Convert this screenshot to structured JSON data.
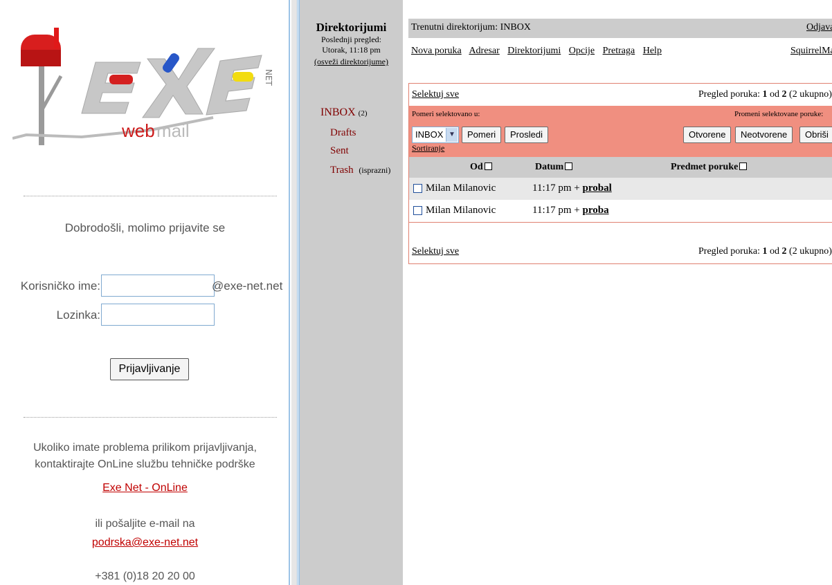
{
  "login": {
    "logo": {
      "brand_text": "exe",
      "brand_suffix": "NET",
      "tagline_bold": "web",
      "tagline_rest": "mail"
    },
    "welcome": "Dobrodošli, molimo prijavite se",
    "username_label": "Korisničko ime:",
    "username_value": "",
    "username_domain": "@exe-net.net",
    "password_label": "Lozinka:",
    "password_value": "",
    "login_button": "Prijavljivanje",
    "help_line1": "Ukoliko imate problema prilikom prijavljivanja,",
    "help_line2": "kontaktirajte OnLine službu tehničke podrške",
    "help_link": "Exe Net - OnLine",
    "email_line": "ili pošaljite e-mail na",
    "email_link": "podrska@exe-net.net",
    "phone": "+381 (0)18 20 20 00"
  },
  "sidebar": {
    "title": "Direktorijumi",
    "last_label": "Poslednji pregled:",
    "last_time": "Utorak, 11:18 pm",
    "refresh": "(osveži direktorijume)",
    "folders": [
      {
        "name": "INBOX",
        "count": "(2)"
      },
      {
        "name": "Drafts"
      },
      {
        "name": "Sent"
      },
      {
        "name": "Trash",
        "extra": "(isprazni)"
      }
    ]
  },
  "main": {
    "current_folder": "Trenutni direktorijum: INBOX",
    "logout": "Odjava",
    "menu": [
      "Nova poruka",
      "Adresar",
      "Direktorijumi",
      "Opcije",
      "Pretraga",
      "Help"
    ],
    "brand_link": "SquirrelMail",
    "select_all": "Selektuj sve",
    "pager_prefix": "Pregled poruka:",
    "pager_from": "1",
    "pager_of": "od",
    "pager_to": "2",
    "pager_suffix": "(2 ukupno)",
    "move_label": "Pomeri selektovano u:",
    "move_target": "INBOX",
    "move_button": "Pomeri",
    "forward_button": "Prosledi",
    "change_label": "Promeni selektovane poruke:",
    "read_button": "Otvorene",
    "unread_button": "Neotvorene",
    "delete_button": "Obriši",
    "sort_link": "Sortiranje",
    "columns": {
      "from": "Od",
      "date": "Datum",
      "subject": "Predmet poruke"
    },
    "messages": [
      {
        "from": "Milan Milanovic",
        "date": "11:17 pm +",
        "subject": "probal"
      },
      {
        "from": "Milan Milanovic",
        "date": "11:17 pm +",
        "subject": "proba"
      }
    ]
  },
  "colors": {
    "sidebar_bg": "#cccccc",
    "action_bar": "#f08f80",
    "frame_border": "#e08070",
    "folder_text": "#800000",
    "link_red": "#c00000",
    "panel_border": "#9cc3e6"
  }
}
